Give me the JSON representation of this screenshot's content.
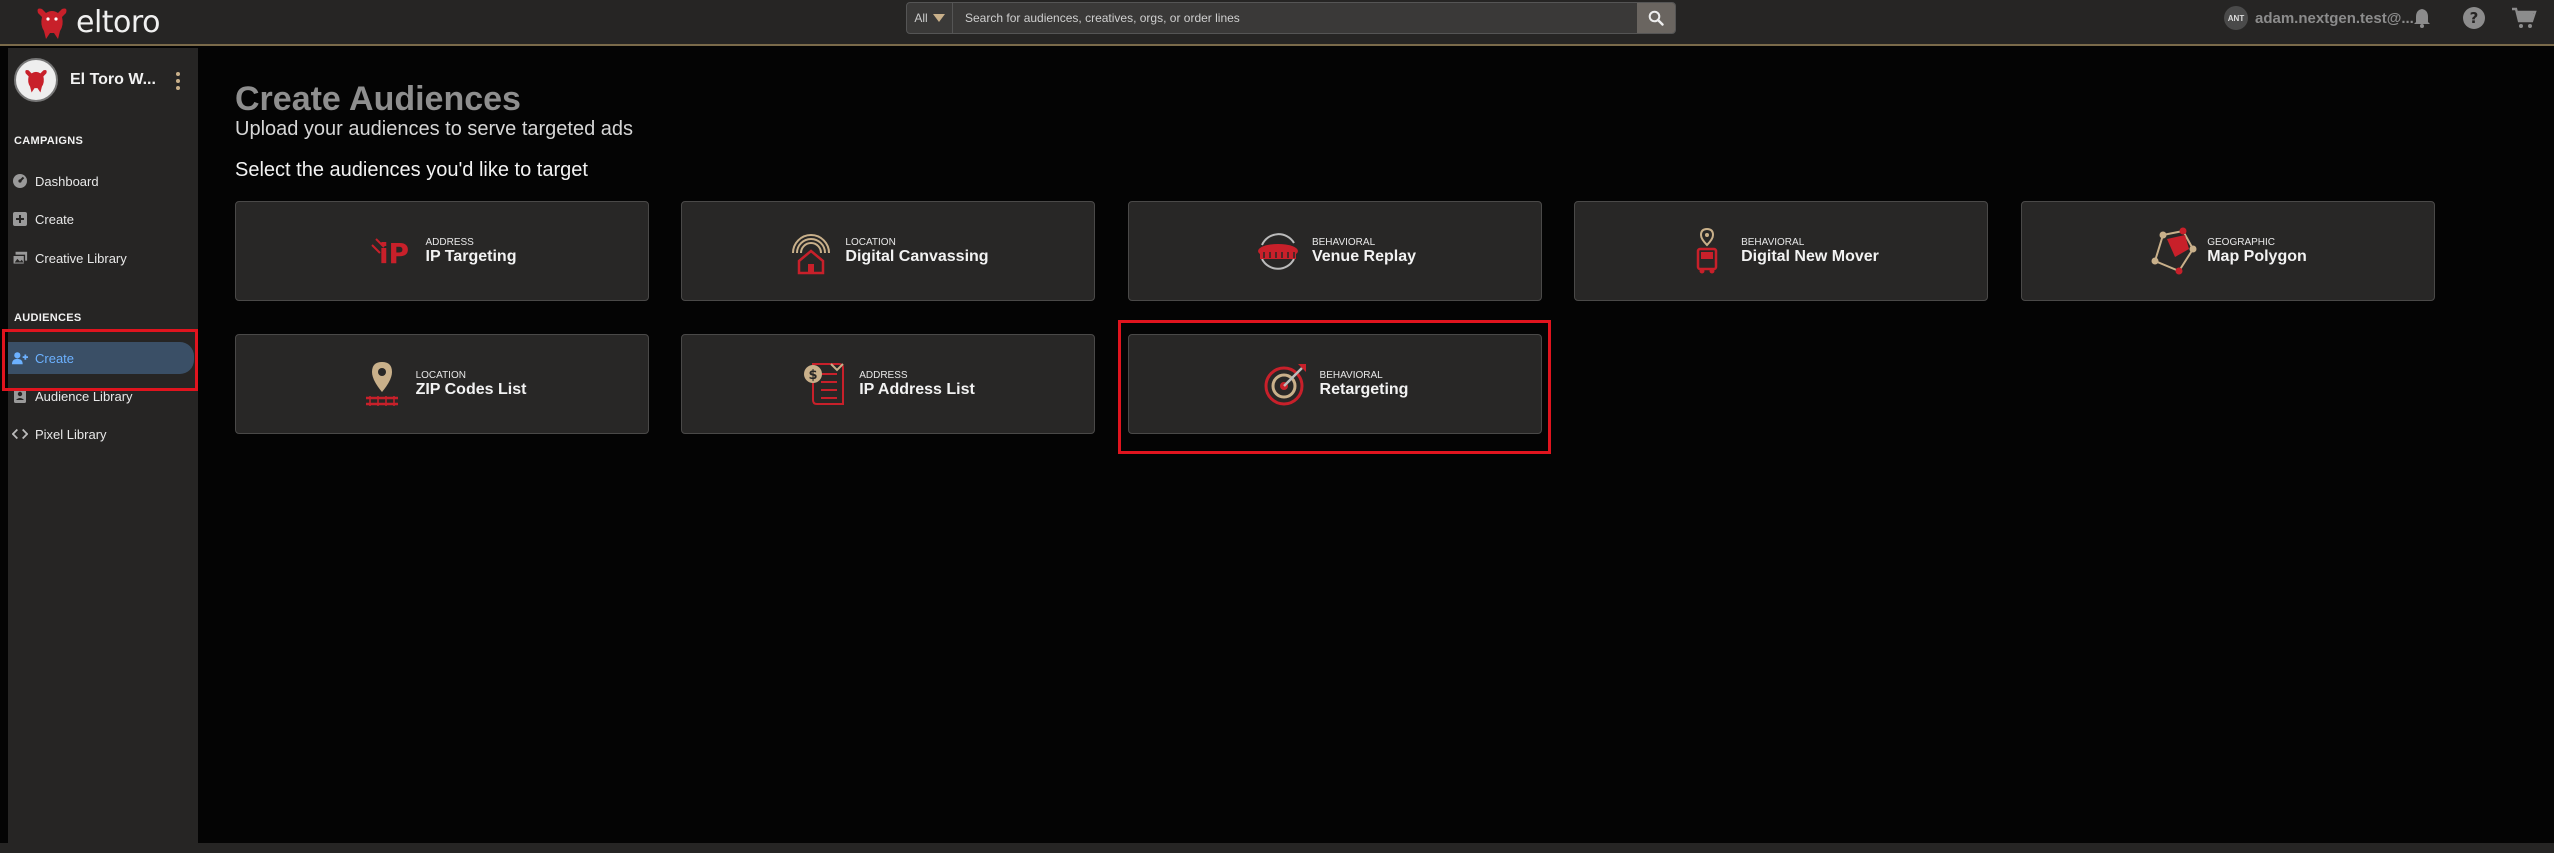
{
  "app": {
    "logo_text": "eltoro"
  },
  "search": {
    "filter_label": "All",
    "placeholder": "Search for audiences, creatives, orgs, or order lines"
  },
  "user": {
    "initials": "ANT",
    "name": "adam.nextgen.test@..."
  },
  "sidebar": {
    "org_name": "El Toro W...",
    "campaigns_label": "CAMPAIGNS",
    "campaign_items": [
      {
        "label": "Dashboard",
        "icon": "dashboard-icon"
      },
      {
        "label": "Create",
        "icon": "plus-square-icon"
      },
      {
        "label": "Creative Library",
        "icon": "images-icon"
      }
    ],
    "audiences_label": "AUDIENCES",
    "audience_items": [
      {
        "label": "Create",
        "icon": "user-plus-icon",
        "active": true
      },
      {
        "label": "Audience Library",
        "icon": "id-card-icon"
      },
      {
        "label": "Pixel Library",
        "icon": "code-icon"
      }
    ]
  },
  "main": {
    "title": "Create Audiences",
    "subtitle": "Upload your audiences to serve targeted ads",
    "prompt": "Select the audiences you'd like to target",
    "cards": [
      {
        "category": "ADDRESS",
        "name": "IP Targeting",
        "icon": "ip-icon"
      },
      {
        "category": "LOCATION",
        "name": "Digital Canvassing",
        "icon": "house-signal-icon"
      },
      {
        "category": "BEHAVIORAL",
        "name": "Venue Replay",
        "icon": "venue-replay-icon"
      },
      {
        "category": "BEHAVIORAL",
        "name": "Digital New Mover",
        "icon": "moving-truck-icon"
      },
      {
        "category": "GEOGRAPHIC",
        "name": "Map Polygon",
        "icon": "map-polygon-icon"
      },
      {
        "category": "LOCATION",
        "name": "ZIP Codes List",
        "icon": "zip-pin-icon"
      },
      {
        "category": "ADDRESS",
        "name": "IP Address List",
        "icon": "address-list-icon"
      },
      {
        "category": "BEHAVIORAL",
        "name": "Retargeting",
        "icon": "target-icon"
      }
    ]
  },
  "colors": {
    "accent_red": "#c8202a",
    "accent_gold": "#c9b08a",
    "active_blue": "#6cb1ff",
    "highlight_red": "#e0141e"
  }
}
